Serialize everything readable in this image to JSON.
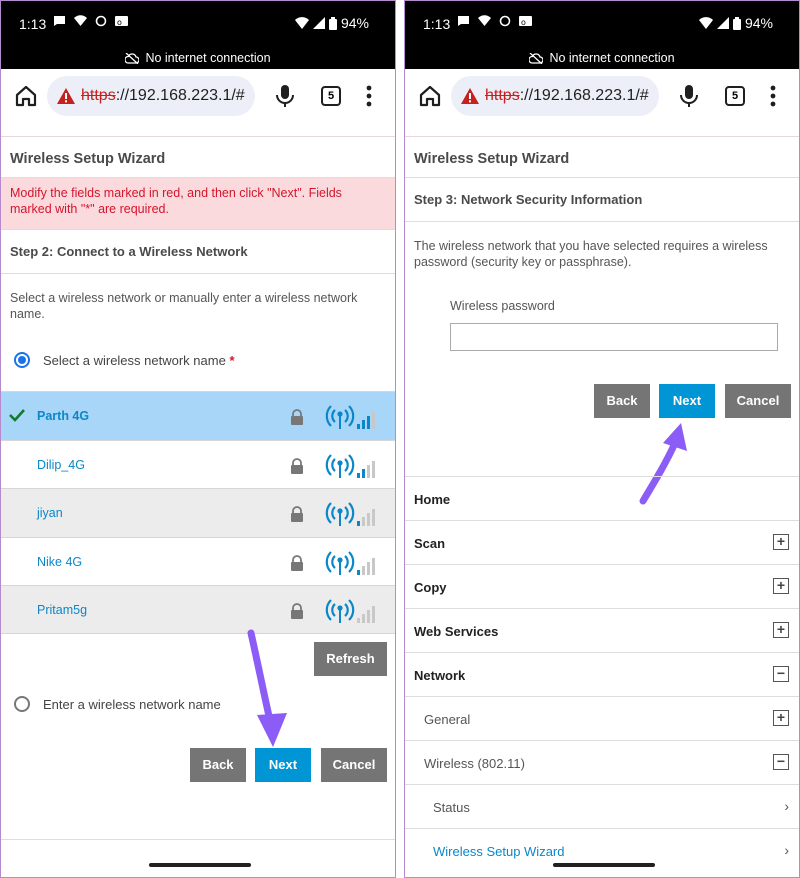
{
  "status": {
    "time": "1:13",
    "battery": "94%"
  },
  "banner": {
    "text": "No internet connection"
  },
  "browser": {
    "url_scheme": "https",
    "url_rest": "://192.168.223.1/#",
    "tab_count": "5"
  },
  "left": {
    "wizard_title": "Wireless Setup Wizard",
    "alert": "Modify the fields marked in red, and then click \"Next\". Fields marked with \"*\" are required.",
    "step": "Step 2: Connect to a Wireless Network",
    "description": "Select a wireless network or manually enter a wireless network name.",
    "select_label": "Select a wireless network name",
    "required_mark": "*",
    "networks": [
      {
        "name": "Parth 4G",
        "selected": true
      },
      {
        "name": "Dilip_4G",
        "selected": false
      },
      {
        "name": "jiyan",
        "selected": false
      },
      {
        "name": "Nike 4G",
        "selected": false
      },
      {
        "name": "Pritam5g",
        "selected": false
      }
    ],
    "refresh_label": "Refresh",
    "enter_label": "Enter a wireless network name",
    "back_label": "Back",
    "next_label": "Next",
    "cancel_label": "Cancel"
  },
  "right": {
    "wizard_title": "Wireless Setup Wizard",
    "step": "Step 3: Network Security Information",
    "description": "The wireless network that you have selected requires a wireless password (security key or passphrase).",
    "password_label": "Wireless password",
    "password_value": "",
    "back_label": "Back",
    "next_label": "Next",
    "cancel_label": "Cancel",
    "menu": [
      {
        "label": "Home",
        "level": 0,
        "control": ""
      },
      {
        "label": "Scan",
        "level": 0,
        "control": "+"
      },
      {
        "label": "Copy",
        "level": 0,
        "control": "+"
      },
      {
        "label": "Web Services",
        "level": 0,
        "control": "+"
      },
      {
        "label": "Network",
        "level": 0,
        "control": "−"
      },
      {
        "label": "General",
        "level": 1,
        "control": "+"
      },
      {
        "label": "Wireless (802.11)",
        "level": 1,
        "control": "−"
      },
      {
        "label": "Status",
        "level": 2,
        "control": "›"
      },
      {
        "label": "Wireless Setup Wizard",
        "level": 2,
        "control": "›"
      }
    ]
  },
  "colors": {
    "accent": "#0096d6",
    "alert_bg": "#fadadd",
    "alert_text": "#d3152d",
    "selected_row": "#a8d6f9",
    "arrow": "#8b5cf6"
  }
}
